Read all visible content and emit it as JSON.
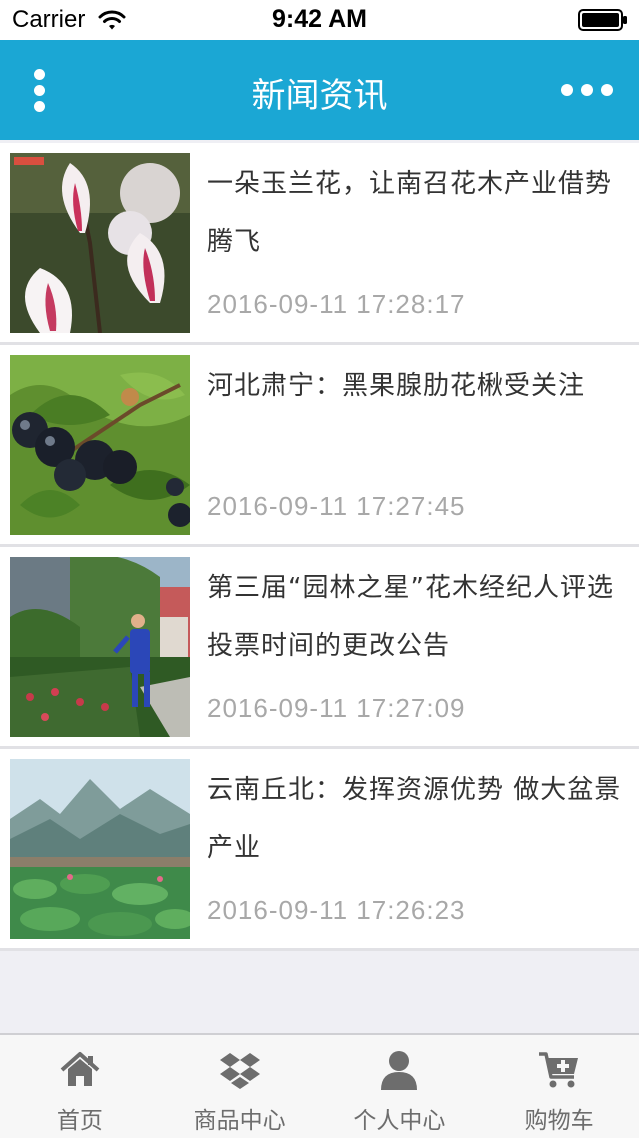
{
  "status_bar": {
    "carrier": "Carrier",
    "time": "9:42 AM"
  },
  "nav": {
    "title": "新闻资讯"
  },
  "news": [
    {
      "title": "一朵玉兰花，让南召花木产业借势腾飞",
      "date": "2016-09-11 17:28:17"
    },
    {
      "title": "河北肃宁：黑果腺肋花楸受关注",
      "date": "2016-09-11 17:27:45"
    },
    {
      "title": "第三届“园林之星”花木经纪人评选投票时间的更改公告",
      "date": "2016-09-11 17:27:09"
    },
    {
      "title": "云南丘北：发挥资源优势 做大盆景产业",
      "date": "2016-09-11 17:26:23"
    }
  ],
  "tabs": [
    {
      "label": "首页",
      "icon": "home-icon"
    },
    {
      "label": "商品中心",
      "icon": "dropbox-icon"
    },
    {
      "label": "个人中心",
      "icon": "user-icon"
    },
    {
      "label": "购物车",
      "icon": "cart-icon"
    }
  ],
  "colors": {
    "nav_bg": "#1ba7d4",
    "title_text": "#333333",
    "date_text": "#a8a8a8",
    "tab_label": "#6d6d6d"
  }
}
